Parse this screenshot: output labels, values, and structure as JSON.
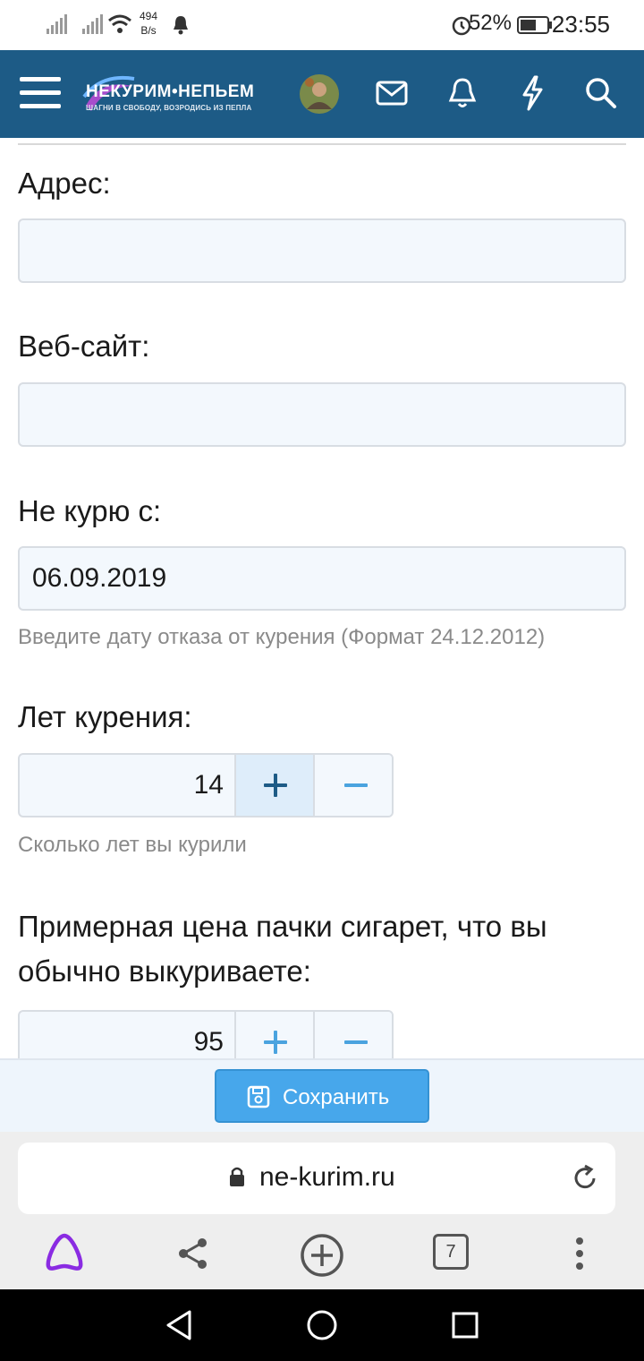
{
  "status_bar": {
    "net_speed": "494",
    "net_speed_unit": "B/s",
    "battery_percent": "52%",
    "time": "23:55"
  },
  "header": {
    "logo_title": "НЕКУРИМ•НЕПЬЕМ",
    "logo_tagline": "ШАГНИ В СВОБОДУ, ВОЗРОДИСЬ ИЗ ПЕПЛА"
  },
  "form": {
    "address": {
      "label": "Адрес:",
      "value": ""
    },
    "website": {
      "label": "Веб-сайт:",
      "value": ""
    },
    "quit_date": {
      "label": "Не курю с:",
      "value": "06.09.2019",
      "hint": "Введите дату отказа от курения (Формат 24.12.2012)"
    },
    "years_smoking": {
      "label": "Лет курения:",
      "value": "14",
      "hint": "Сколько лет вы курили"
    },
    "pack_price": {
      "label_line1": "Примерная цена пачки сигарет, что вы",
      "label_line2": "обычно выкуриваете:",
      "value": "95"
    },
    "save_label": "Сохранить"
  },
  "browser": {
    "url": "ne-kurim.ru",
    "tabs_count": "7"
  },
  "colors": {
    "header_bg": "#1d5b86",
    "accent": "#47a7eb",
    "alice_purple": "#8a2be2"
  }
}
